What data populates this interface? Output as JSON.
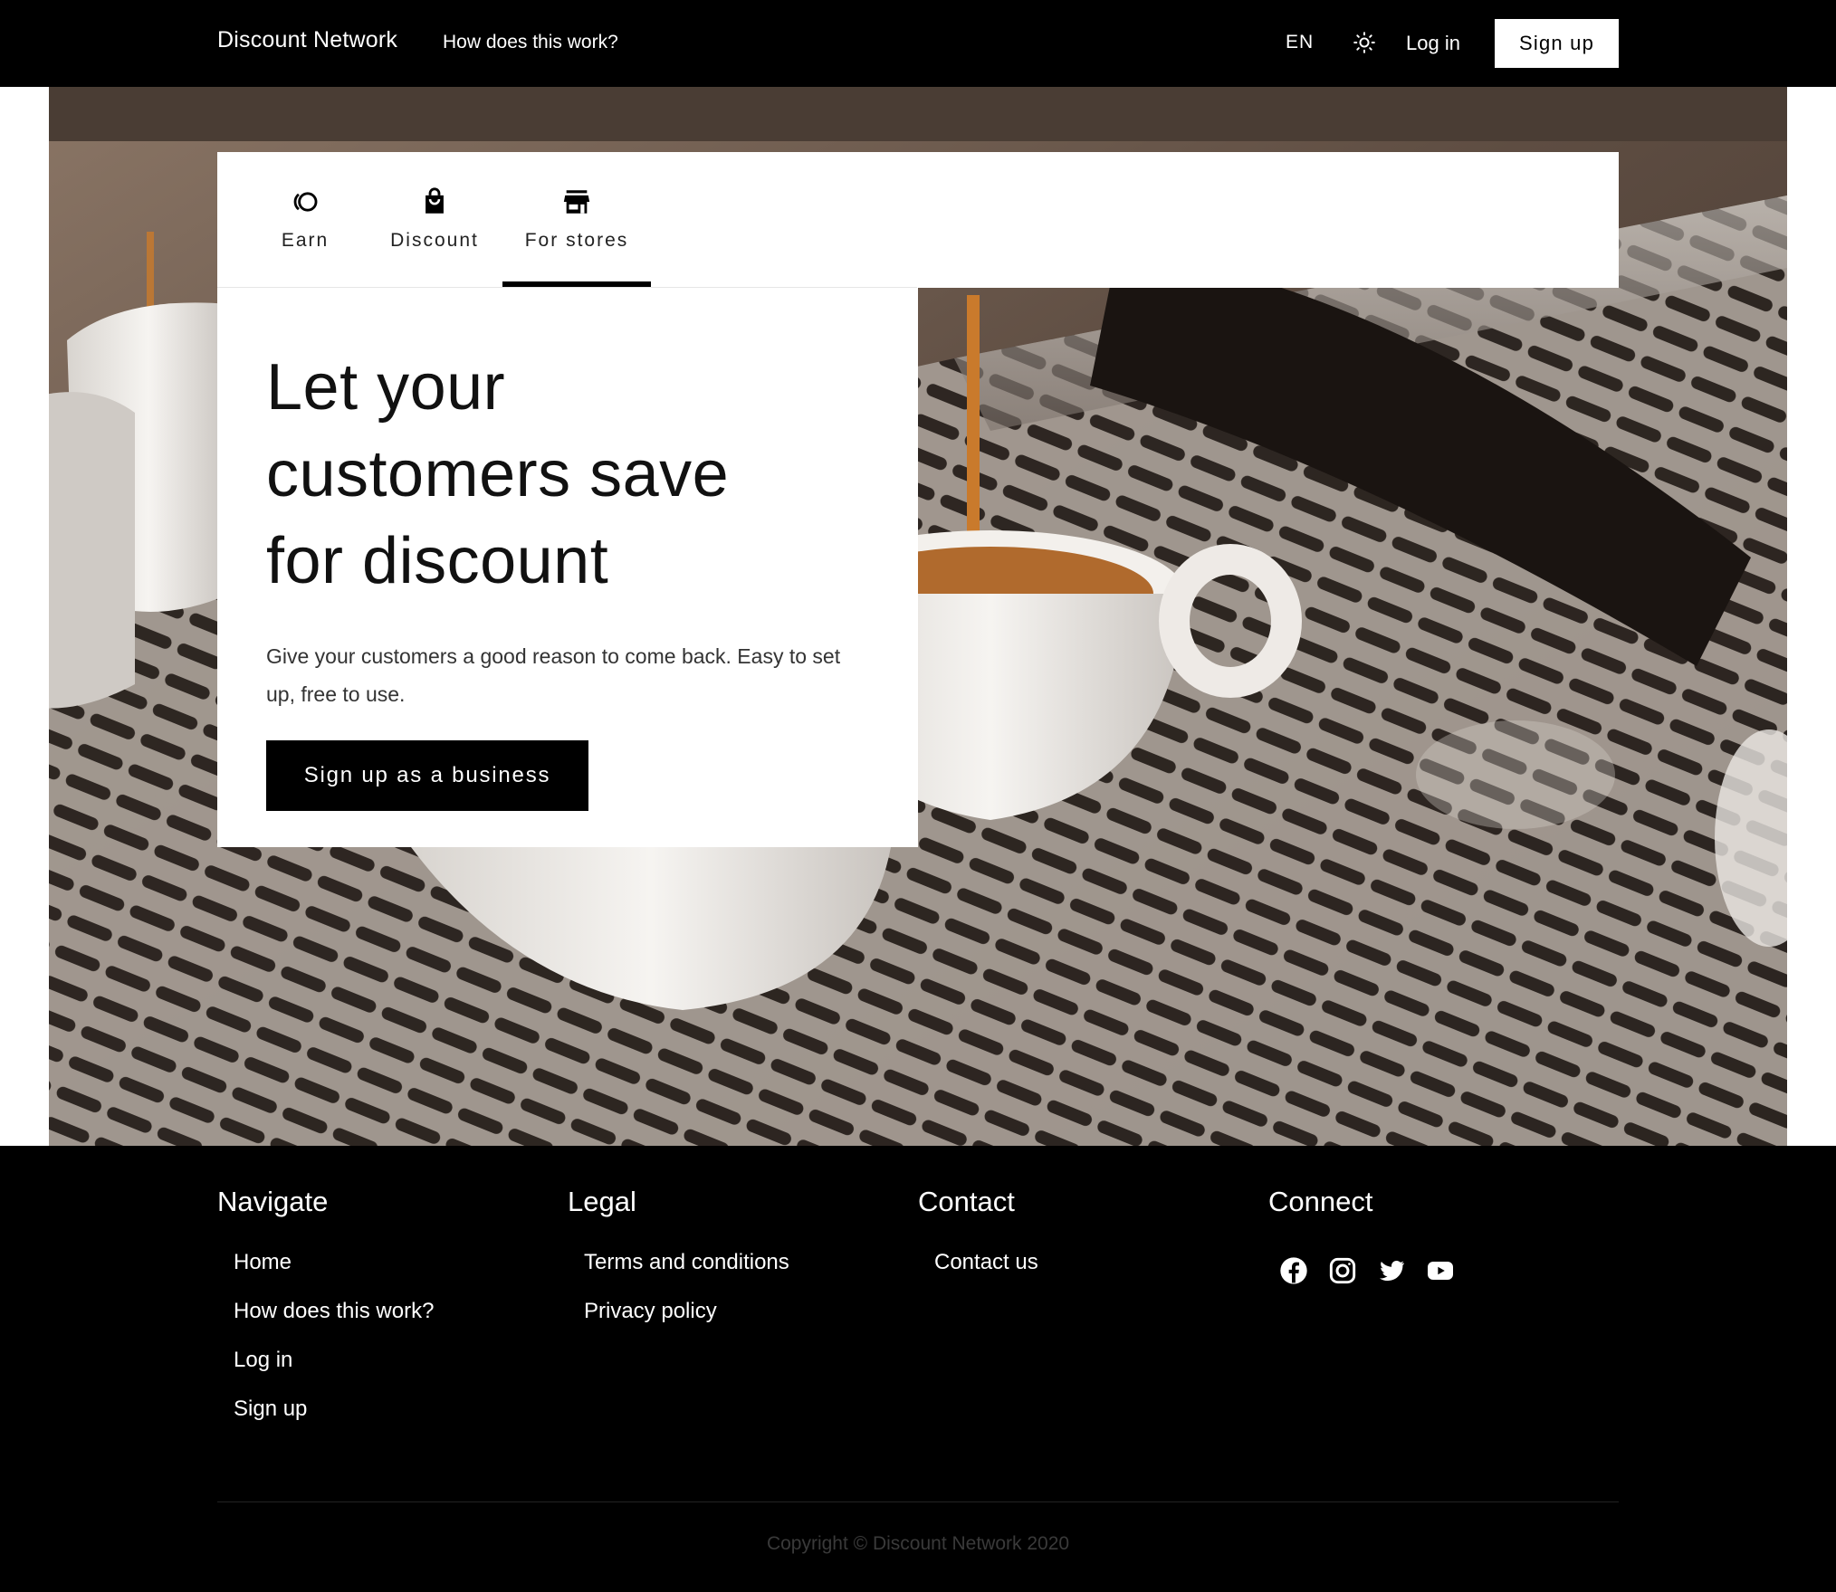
{
  "header": {
    "brand": "Discount Network",
    "how": "How does this work?",
    "language": "EN",
    "theme_icon": "lightbulb-icon",
    "login": "Log in",
    "signup": "Sign up"
  },
  "tabs": [
    {
      "label": "Earn",
      "icon": "coins-icon"
    },
    {
      "label": "Discount",
      "icon": "shopping-bag-icon"
    },
    {
      "label": "For stores",
      "icon": "storefront-icon",
      "active": true
    }
  ],
  "hero": {
    "headline_lines": [
      "Let your",
      "customers save",
      "for discount"
    ],
    "subtext": "Give your customers a good reason to come back. Easy to set up, free to use.",
    "cta": "Sign up as a business"
  },
  "footer": {
    "navigate": {
      "title": "Navigate",
      "links": [
        "Home",
        "How does this work?",
        "Log in",
        "Sign up"
      ]
    },
    "legal": {
      "title": "Legal",
      "links": [
        "Terms and conditions",
        "Privacy policy"
      ]
    },
    "contact": {
      "title": "Contact",
      "links": [
        "Contact us"
      ]
    },
    "connect": {
      "title": "Connect",
      "icons": [
        "facebook-icon",
        "instagram-icon",
        "twitter-icon",
        "youtube-icon"
      ]
    },
    "copyright": "Copyright © Discount Network 2020"
  },
  "colors": {
    "primary": "#000000",
    "background": "#ffffff",
    "copyright_text": "#3a3a3a"
  }
}
